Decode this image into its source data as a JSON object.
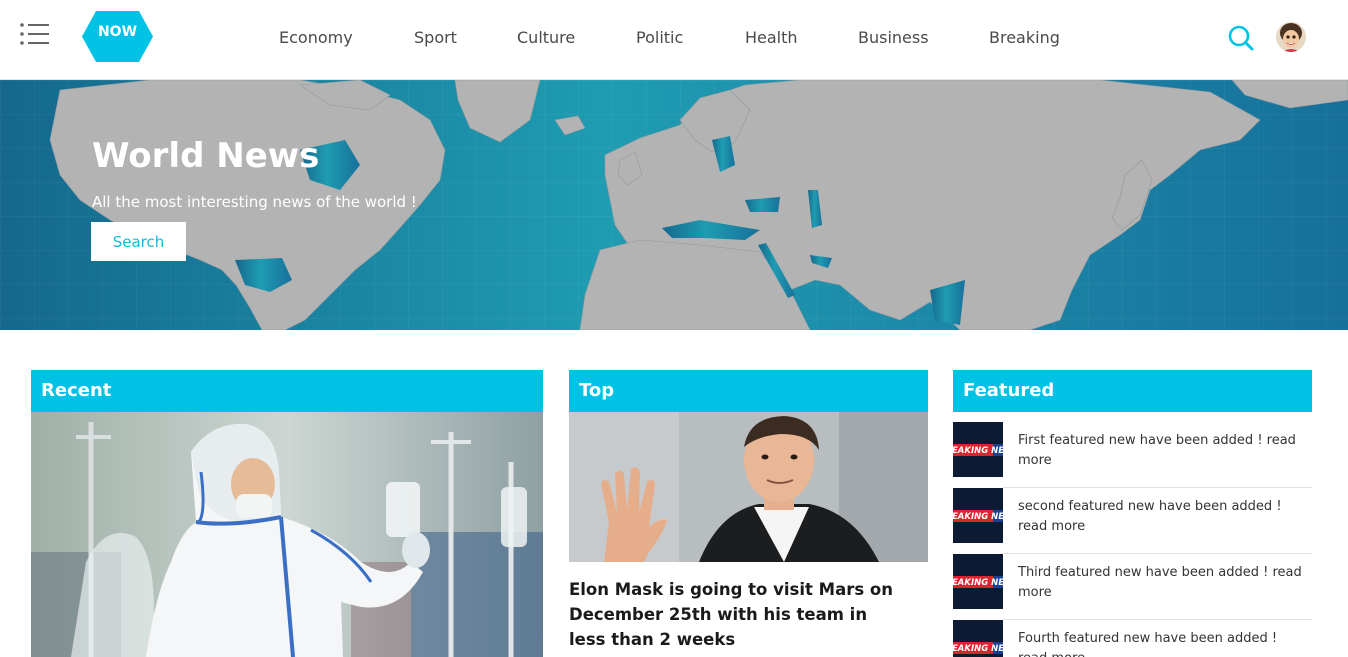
{
  "header": {
    "logo_text": "NOW",
    "nav": [
      "Economy",
      "Sport",
      "Culture",
      "Politic",
      "Health",
      "Business",
      "Breaking"
    ]
  },
  "hero": {
    "title": "World News",
    "subtitle": "All the most interesting news of the world !",
    "button_label": "Search"
  },
  "sections": {
    "recent": {
      "label": "Recent"
    },
    "top": {
      "label": "Top",
      "headline": "Elon Mask is going to visit Mars on December 25th with his team in less than 2 weeks"
    },
    "featured": {
      "label": "Featured",
      "thumb_text": "EAKING NE",
      "items": [
        "First featured new have been added ! read more",
        "second featured new have been added ! read more",
        "Third featured new have been added ! read more",
        "Fourth featured new have been added ! read more"
      ]
    }
  },
  "colors": {
    "accent": "#00c2e5",
    "hero_bg": "#1e7b9b",
    "land": "#b3b3b3"
  }
}
